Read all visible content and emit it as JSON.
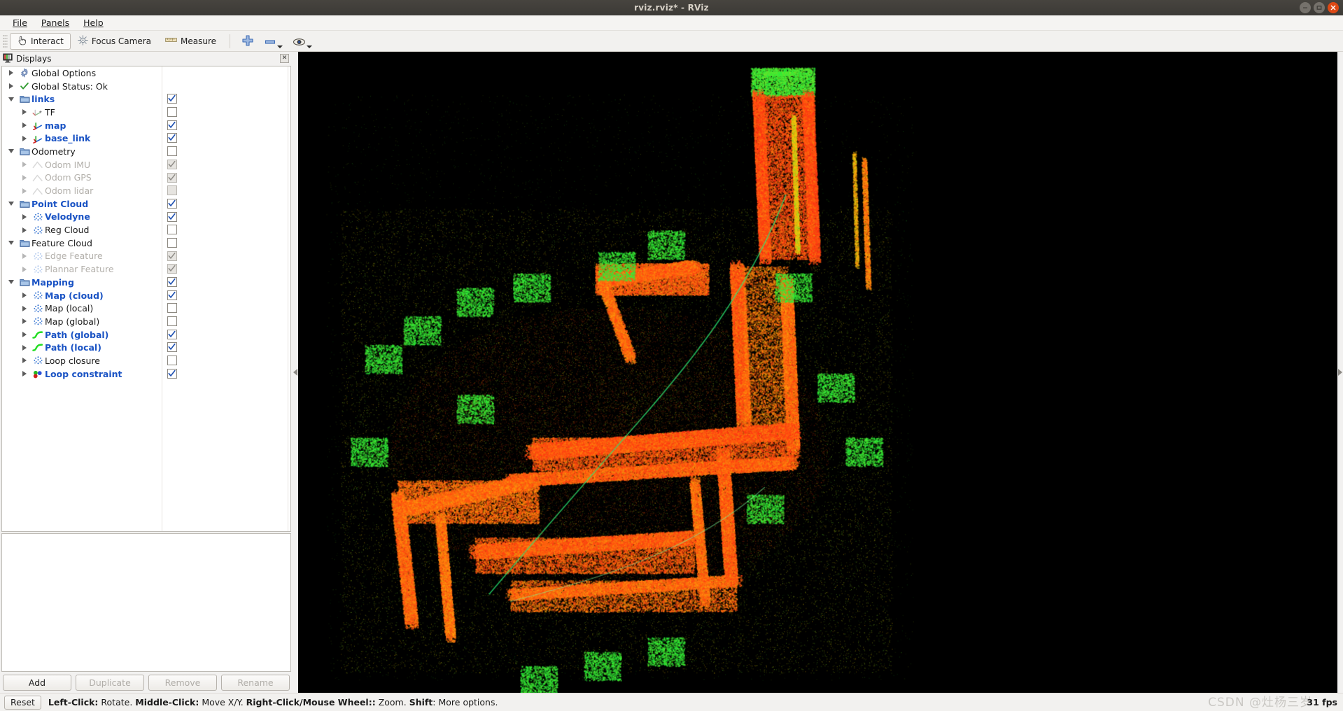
{
  "window": {
    "title": "rviz.rviz* - RViz",
    "controls": [
      {
        "name": "minimize",
        "glyph": "–"
      },
      {
        "name": "maximize",
        "glyph": "□"
      },
      {
        "name": "close",
        "glyph": "×"
      }
    ]
  },
  "menubar": {
    "items": [
      {
        "label": "File",
        "mnemonic": "F"
      },
      {
        "label": "Panels",
        "mnemonic": "P"
      },
      {
        "label": "Help",
        "mnemonic": "H"
      }
    ]
  },
  "toolbar": {
    "buttons": [
      {
        "label": "Interact",
        "icon": "hand-cursor-icon",
        "active": true
      },
      {
        "label": "Focus Camera",
        "icon": "focus-camera-icon",
        "active": false
      },
      {
        "label": "Measure",
        "icon": "ruler-icon",
        "active": false
      }
    ],
    "icon_buttons": [
      {
        "name": "add-pose-estimate-icon",
        "glyph": "plus"
      },
      {
        "name": "minus-icon",
        "glyph": "minus"
      },
      {
        "name": "publish-point-eye-icon",
        "glyph": "eye"
      }
    ]
  },
  "displays_panel": {
    "title": "Displays",
    "icon": "displays-icon",
    "close_label": "✕",
    "tree": [
      {
        "label": "Global Options",
        "indent": 0,
        "expander": "right",
        "icon": "gear-icon",
        "style": "normal",
        "check": "none"
      },
      {
        "label": "Global Status: Ok",
        "indent": 0,
        "expander": "right",
        "icon": "check-icon",
        "style": "normal",
        "check": "none"
      },
      {
        "label": "links",
        "indent": 0,
        "expander": "down",
        "icon": "folder-icon",
        "style": "blue",
        "check": "checked"
      },
      {
        "label": "TF",
        "indent": 1,
        "expander": "right",
        "icon": "axes-tf-icon",
        "style": "normal",
        "check": "unchecked"
      },
      {
        "label": "map",
        "indent": 1,
        "expander": "right",
        "icon": "axes-icon",
        "style": "blue",
        "check": "checked"
      },
      {
        "label": "base_link",
        "indent": 1,
        "expander": "right",
        "icon": "axes-icon",
        "style": "blue",
        "check": "checked"
      },
      {
        "label": "Odometry",
        "indent": 0,
        "expander": "down",
        "icon": "folder-icon",
        "style": "normal",
        "check": "unchecked"
      },
      {
        "label": "Odom IMU",
        "indent": 1,
        "expander": "right",
        "icon": "odom-icon",
        "style": "dim",
        "check": "checked-dim"
      },
      {
        "label": "Odom GPS",
        "indent": 1,
        "expander": "right",
        "icon": "odom-icon",
        "style": "dim",
        "check": "checked-dim"
      },
      {
        "label": "Odom lidar",
        "indent": 1,
        "expander": "right",
        "icon": "odom-icon",
        "style": "dim",
        "check": "unchecked-dim"
      },
      {
        "label": "Point Cloud",
        "indent": 0,
        "expander": "down",
        "icon": "folder-icon",
        "style": "blue",
        "check": "checked"
      },
      {
        "label": "Velodyne",
        "indent": 1,
        "expander": "right",
        "icon": "pointcloud-icon",
        "style": "blue",
        "check": "checked"
      },
      {
        "label": "Reg Cloud",
        "indent": 1,
        "expander": "right",
        "icon": "pointcloud-icon",
        "style": "normal",
        "check": "unchecked"
      },
      {
        "label": "Feature Cloud",
        "indent": 0,
        "expander": "down",
        "icon": "folder-icon",
        "style": "normal",
        "check": "unchecked"
      },
      {
        "label": "Edge Feature",
        "indent": 1,
        "expander": "right",
        "icon": "pointcloud-icon",
        "style": "dim",
        "check": "checked-dim"
      },
      {
        "label": "Plannar Feature",
        "indent": 1,
        "expander": "right",
        "icon": "pointcloud-icon",
        "style": "dim",
        "check": "checked-dim"
      },
      {
        "label": "Mapping",
        "indent": 0,
        "expander": "down",
        "icon": "folder-icon",
        "style": "blue",
        "check": "checked"
      },
      {
        "label": "Map (cloud)",
        "indent": 1,
        "expander": "right",
        "icon": "pointcloud-icon",
        "style": "blue",
        "check": "checked"
      },
      {
        "label": "Map (local)",
        "indent": 1,
        "expander": "right",
        "icon": "pointcloud-icon",
        "style": "normal",
        "check": "unchecked"
      },
      {
        "label": "Map (global)",
        "indent": 1,
        "expander": "right",
        "icon": "pointcloud-icon",
        "style": "normal",
        "check": "unchecked"
      },
      {
        "label": "Path (global)",
        "indent": 1,
        "expander": "right",
        "icon": "path-icon",
        "style": "blue",
        "check": "checked"
      },
      {
        "label": "Path (local)",
        "indent": 1,
        "expander": "right",
        "icon": "path-icon",
        "style": "blue",
        "check": "checked"
      },
      {
        "label": "Loop closure",
        "indent": 1,
        "expander": "right",
        "icon": "pointcloud-icon",
        "style": "normal",
        "check": "unchecked"
      },
      {
        "label": "Loop constraint",
        "indent": 1,
        "expander": "right",
        "icon": "markers-icon",
        "style": "blue",
        "check": "checked"
      }
    ],
    "buttons": [
      {
        "label": "Add",
        "enabled": true
      },
      {
        "label": "Duplicate",
        "enabled": false
      },
      {
        "label": "Remove",
        "enabled": false
      },
      {
        "label": "Rename",
        "enabled": false
      }
    ]
  },
  "statusbar": {
    "reset_label": "Reset",
    "hint_parts": [
      {
        "text": "Left-Click:",
        "bold": true
      },
      {
        "text": " Rotate. ",
        "bold": false
      },
      {
        "text": "Middle-Click:",
        "bold": true
      },
      {
        "text": " Move X/Y. ",
        "bold": false
      },
      {
        "text": "Right-Click/Mouse Wheel::",
        "bold": true
      },
      {
        "text": " Zoom. ",
        "bold": false
      },
      {
        "text": "Shift",
        "bold": true
      },
      {
        "text": ": More options.",
        "bold": false
      }
    ],
    "fps": "31 fps",
    "watermark": "CSDN @灶杨三岁"
  },
  "viewport": {
    "name": "3d-render-view",
    "background": "#000000",
    "scene": "lidar point cloud map of a building complex, intensity colormap from green (low) through yellow/orange to red (high)"
  },
  "colors": {
    "accent_blue": "#1a53c4",
    "titlebar": "#3f3d39",
    "close_button": "#dd4814",
    "panel_bg": "#f2f1f0"
  }
}
